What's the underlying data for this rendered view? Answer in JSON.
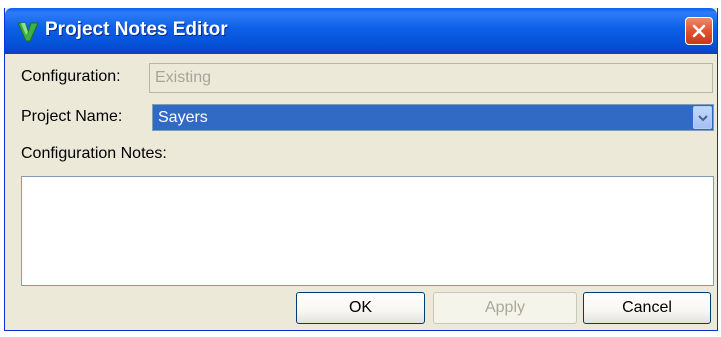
{
  "window": {
    "title": "Project Notes Editor",
    "icon": "green-v-logo-icon",
    "close_icon": "close-icon"
  },
  "form": {
    "configuration_label": "Configuration:",
    "configuration_value": "Existing",
    "project_name_label": "Project Name:",
    "project_name_value": "Sayers",
    "notes_label": "Configuration Notes:",
    "notes_value": ""
  },
  "buttons": {
    "ok": "OK",
    "apply": "Apply",
    "cancel": "Cancel"
  },
  "colors": {
    "titlebar": "#0552d7",
    "selection": "#316ac5",
    "close": "#e0532e",
    "dialog_bg": "#ece9d8"
  }
}
